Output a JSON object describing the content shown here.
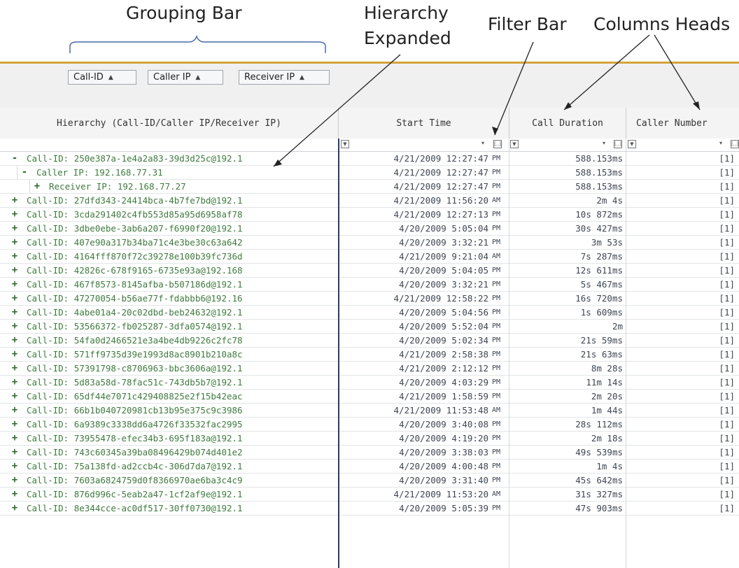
{
  "annotations": {
    "grouping_bar": "Grouping Bar",
    "hierarchy_expanded_line1": "Hierarchy",
    "hierarchy_expanded_line2": "Expanded",
    "filter_bar": "Filter Bar",
    "columns_heads": "Columns Heads"
  },
  "group_panel": {
    "chips": [
      "Call-ID",
      "Caller IP",
      "Receiver IP"
    ],
    "sort_glyph": "▲"
  },
  "columns": {
    "hierarchy": "Hierarchy (Call-ID/Caller IP/Receiver IP)",
    "start_time": "Start Time",
    "call_duration": "Call Duration",
    "caller_number": "Caller Number"
  },
  "filter_bar": {
    "box_glyph": "[..]",
    "filter_glyph": "▼",
    "dropdown_glyph": "▾"
  },
  "rows": [
    {
      "level": 0,
      "expander": "-",
      "text": "Call-ID: 250e387a-1e4a2a83-39d3d25c@192.1",
      "time": "4/21/2009 12:27:47",
      "ampm": "PM",
      "duration": "588.153ms",
      "caller": "[1]"
    },
    {
      "level": 1,
      "expander": "-",
      "text": "Caller IP: 192.168.77.31",
      "time": "4/21/2009 12:27:47",
      "ampm": "PM",
      "duration": "588.153ms",
      "caller": "[1]"
    },
    {
      "level": 2,
      "expander": "+",
      "text": "Receiver IP: 192.168.77.27",
      "time": "4/21/2009 12:27:47",
      "ampm": "PM",
      "duration": "588.153ms",
      "caller": "[1]"
    },
    {
      "level": 0,
      "expander": "+",
      "text": "Call-ID: 27dfd343-24414bca-4b7fe7bd@192.1",
      "time": "4/21/2009 11:56:20",
      "ampm": "AM",
      "duration": "2m 4s",
      "caller": "[1]"
    },
    {
      "level": 0,
      "expander": "+",
      "text": "Call-ID: 3cda291402c4fb553d85a95d6958af78",
      "time": "4/21/2009 12:27:13",
      "ampm": "PM",
      "duration": "10s 872ms",
      "caller": "[1]"
    },
    {
      "level": 0,
      "expander": "+",
      "text": "Call-ID: 3dbe0ebe-3ab6a207-f6990f20@192.1",
      "time": "4/20/2009 5:05:04",
      "ampm": "PM",
      "duration": "30s 427ms",
      "caller": "[1]"
    },
    {
      "level": 0,
      "expander": "+",
      "text": "Call-ID: 407e90a317b34ba71c4e3be30c63a642",
      "time": "4/20/2009 3:32:21",
      "ampm": "PM",
      "duration": "3m 53s",
      "caller": "[1]"
    },
    {
      "level": 0,
      "expander": "+",
      "text": "Call-ID: 4164fff870f72c39278e100b39fc736d",
      "time": "4/21/2009 9:21:04",
      "ampm": "AM",
      "duration": "7s 287ms",
      "caller": "[1]"
    },
    {
      "level": 0,
      "expander": "+",
      "text": "Call-ID: 42826c-678f9165-6735e93a@192.168",
      "time": "4/20/2009 5:04:05",
      "ampm": "PM",
      "duration": "12s 611ms",
      "caller": "[1]"
    },
    {
      "level": 0,
      "expander": "+",
      "text": "Call-ID: 467f8573-8145afba-b507186d@192.1",
      "time": "4/20/2009 3:32:21",
      "ampm": "PM",
      "duration": "5s 467ms",
      "caller": "[1]"
    },
    {
      "level": 0,
      "expander": "+",
      "text": "Call-ID: 47270054-b56ae77f-fdabbb6@192.16",
      "time": "4/21/2009 12:58:22",
      "ampm": "PM",
      "duration": "16s 720ms",
      "caller": "[1]"
    },
    {
      "level": 0,
      "expander": "+",
      "text": "Call-ID: 4abe01a4-20c02dbd-beb24632@192.1",
      "time": "4/20/2009 5:04:56",
      "ampm": "PM",
      "duration": "1s 609ms",
      "caller": "[1]"
    },
    {
      "level": 0,
      "expander": "+",
      "text": "Call-ID: 53566372-fb025287-3dfa0574@192.1",
      "time": "4/20/2009 5:52:04",
      "ampm": "PM",
      "duration": "2m",
      "caller": "[1]"
    },
    {
      "level": 0,
      "expander": "+",
      "text": "Call-ID: 54fa0d2466521e3a4be4db9226c2fc78",
      "time": "4/20/2009 5:02:34",
      "ampm": "PM",
      "duration": "21s 59ms",
      "caller": "[1]"
    },
    {
      "level": 0,
      "expander": "+",
      "text": "Call-ID: 571ff9735d39e1993d8ac8901b210a8c",
      "time": "4/21/2009 2:58:38",
      "ampm": "PM",
      "duration": "21s 63ms",
      "caller": "[1]"
    },
    {
      "level": 0,
      "expander": "+",
      "text": "Call-ID: 57391798-c8706963-bbc3606a@192.1",
      "time": "4/21/2009 2:12:12",
      "ampm": "PM",
      "duration": "8m 28s",
      "caller": "[1]"
    },
    {
      "level": 0,
      "expander": "+",
      "text": "Call-ID: 5d83a58d-78fac51c-743db5b7@192.1",
      "time": "4/20/2009 4:03:29",
      "ampm": "PM",
      "duration": "11m 14s",
      "caller": "[1]"
    },
    {
      "level": 0,
      "expander": "+",
      "text": "Call-ID: 65df44e7071c429408825e2f15b42eac",
      "time": "4/21/2009 1:58:59",
      "ampm": "PM",
      "duration": "2m 20s",
      "caller": "[1]"
    },
    {
      "level": 0,
      "expander": "+",
      "text": "Call-ID: 66b1b040720981cb13b95e375c9c3986",
      "time": "4/21/2009 11:53:48",
      "ampm": "AM",
      "duration": "1m 44s",
      "caller": "[1]"
    },
    {
      "level": 0,
      "expander": "+",
      "text": "Call-ID: 6a9389c3338dd6a4726f33532fac2995",
      "time": "4/20/2009 3:40:08",
      "ampm": "PM",
      "duration": "28s 112ms",
      "caller": "[1]"
    },
    {
      "level": 0,
      "expander": "+",
      "text": "Call-ID: 73955478-efec34b3-695f183a@192.1",
      "time": "4/20/2009 4:19:20",
      "ampm": "PM",
      "duration": "2m 18s",
      "caller": "[1]"
    },
    {
      "level": 0,
      "expander": "+",
      "text": "Call-ID: 743c60345a39ba08496429b074d401e2",
      "time": "4/20/2009 3:38:03",
      "ampm": "PM",
      "duration": "49s 539ms",
      "caller": "[1]"
    },
    {
      "level": 0,
      "expander": "+",
      "text": "Call-ID: 75a138fd-ad2ccb4c-306d7da7@192.1",
      "time": "4/20/2009 4:00:48",
      "ampm": "PM",
      "duration": "1m 4s",
      "caller": "[1]"
    },
    {
      "level": 0,
      "expander": "+",
      "text": "Call-ID: 7603a6824759d0f8366970ae6ba3c4c9",
      "time": "4/20/2009 3:31:40",
      "ampm": "PM",
      "duration": "45s 642ms",
      "caller": "[1]"
    },
    {
      "level": 0,
      "expander": "+",
      "text": "Call-ID: 876d996c-5eab2a47-1cf2af9e@192.1",
      "time": "4/21/2009 11:53:20",
      "ampm": "AM",
      "duration": "31s 327ms",
      "caller": "[1]"
    },
    {
      "level": 0,
      "expander": "+",
      "text": "Call-ID: 8e344cce-ac0df517-30ff0730@192.1",
      "time": "4/20/2009 5:05:39",
      "ampm": "PM",
      "duration": "47s 903ms",
      "caller": "[1]"
    }
  ]
}
